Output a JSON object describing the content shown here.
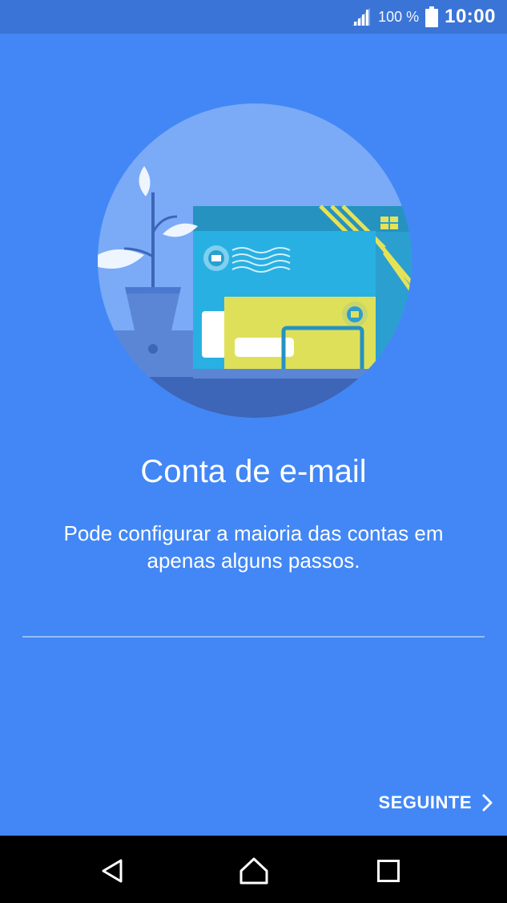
{
  "status_bar": {
    "battery_percent": "100 %",
    "time": "10:00",
    "icons": [
      "signal-icon",
      "battery-icon"
    ]
  },
  "main": {
    "title": "Conta de e-mail",
    "description": "Pode configurar a maioria das contas em apenas alguns passos.",
    "next_button_label": "SEGUINTE"
  },
  "nav_bar": {
    "icons": [
      "back-icon",
      "home-icon",
      "recents-icon"
    ]
  },
  "colors": {
    "background": "#4287f5",
    "status_bar": "#3a74d6",
    "illustration_circle": "#7baaf7",
    "nav_bar": "#000000",
    "text": "#ffffff"
  }
}
